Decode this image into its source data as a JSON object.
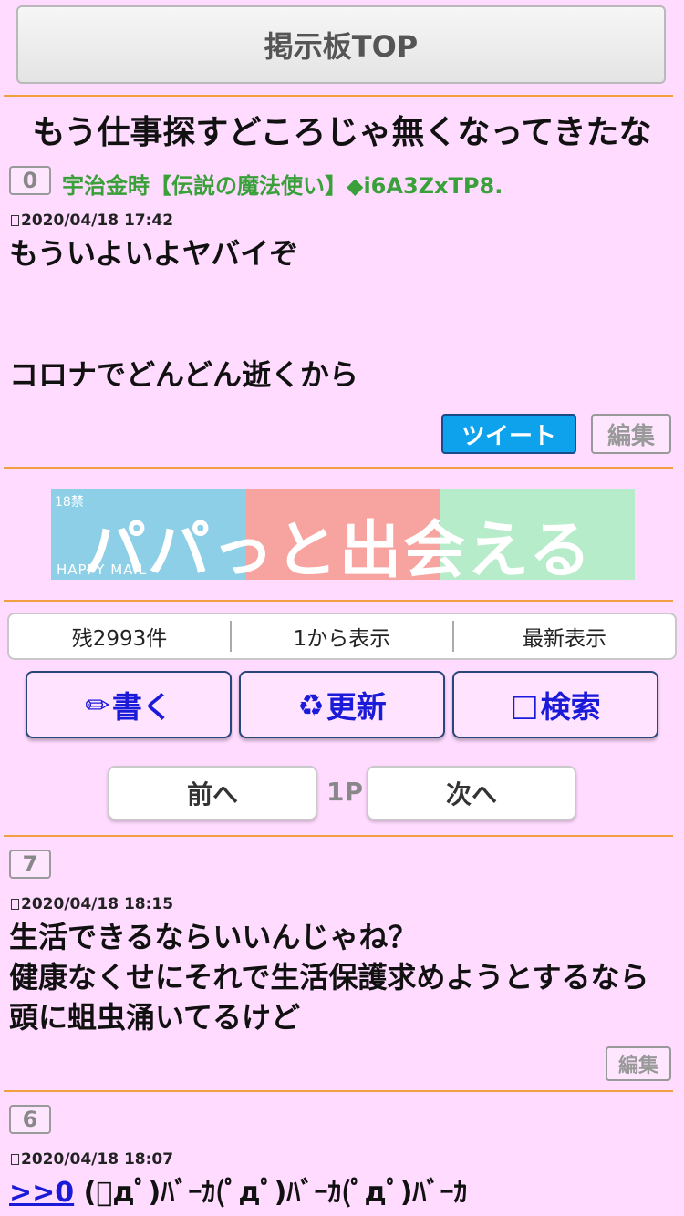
{
  "header": {
    "top_button": "掲示板TOP"
  },
  "thread": {
    "title": "もう仕事探すどころじゃ無くなってきたな",
    "op": {
      "number": "0",
      "author": "宇治金時【伝説の魔法使い】◆i6A3ZxTP8.",
      "date": "2020/04/18 17:42",
      "lines": [
        "もういよいよヤバイぞ",
        "コロナでどんどん逝くから"
      ],
      "tweet_label": "ツイート",
      "edit_label": "編集"
    }
  },
  "banner": {
    "age": "18禁",
    "catchphrase": "パパっと出会える",
    "brand": "HAPPY MAIL",
    "colors": [
      "#8ecfe8",
      "#f7a3a0",
      "#b6ecc9"
    ]
  },
  "info": {
    "remaining": "残2993件",
    "from_first": "1から表示",
    "latest": "最新表示"
  },
  "actions": {
    "write": {
      "icon": "✏",
      "label": "書く"
    },
    "refresh": {
      "icon": "♻",
      "label": "更新"
    },
    "search": {
      "icon": "□",
      "label": "検索"
    }
  },
  "pager": {
    "prev": "前へ",
    "page": "1P",
    "next": "次へ"
  },
  "posts": [
    {
      "number": "7",
      "date": "2020/04/18 18:15",
      "lines": [
        "生活できるならいいんじゃね？",
        "健康なくせにそれで生活保護求めようとするなら",
        "頭に蛆虫涌いてるけど"
      ],
      "edit_label": "編集"
    },
    {
      "number": "6",
      "date": "2020/04/18 18:07",
      "anchor": ">>0",
      "text": "(ﾟдﾟ)ﾊﾞｰｶ(ﾟдﾟ)ﾊﾞｰｶ(ﾟдﾟ)ﾊﾞｰｶ"
    }
  ]
}
